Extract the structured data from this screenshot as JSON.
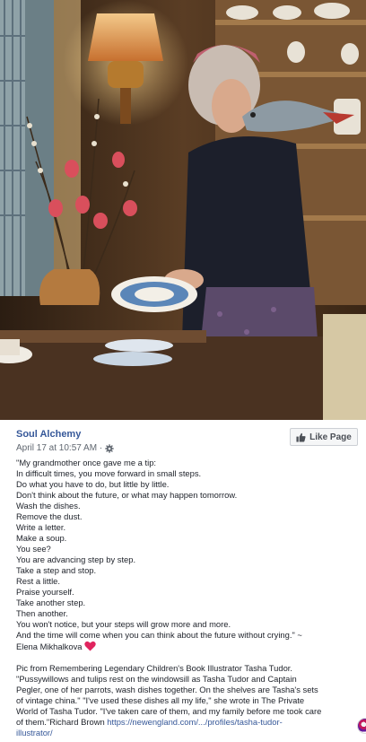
{
  "post": {
    "page_name": "Soul Alchemy",
    "timestamp": "April 17 at 10:57 AM ·",
    "like_button_label": "Like Page",
    "quote_lines": [
      "\"My grandmother once gave me a tip:",
      "In difficult times, you move forward in small steps.",
      "Do what you have to do, but little by little.",
      "Don't think about the future, or what may happen tomorrow.",
      "Wash the dishes.",
      "Remove the dust.",
      "Write a letter.",
      "Make a soup.",
      "You see?",
      "You are advancing step by step.",
      "Take a step and stop.",
      "Rest a little.",
      "Praise yourself.",
      "Take another step.",
      "Then another.",
      "You won't notice, but your steps will grow more and more.",
      "And the time will come when you can think about the future without crying.\" ~"
    ],
    "author": "Elena Mikhalkova",
    "caption_lines": [
      "Pic from Remembering Legendary Children's Book Illustrator Tasha Tudor.",
      "\"Pussywillows and tulips rest on the windowsill as Tasha Tudor and Captain",
      "Pegler, one of her parrots, wash dishes together. On the shelves are Tasha's sets",
      "of vintage china.\" \"I've used these dishes all my life,\" she wrote in The Private",
      "World of Tasha Tudor. \"I've taken care of them, and my family before me took care"
    ],
    "caption_tail": "of them.\"Richard Brown ",
    "link_line1": "https://newengland.com/.../profiles/tasha-tudor-",
    "link_line2": "illustrator/"
  },
  "icons": {
    "audience": "gear-icon",
    "like": "thumbs-up-icon",
    "heart": "red-heart-icon"
  },
  "colors": {
    "link": "#365899",
    "meta": "#606770",
    "heart": "#e0245e"
  }
}
